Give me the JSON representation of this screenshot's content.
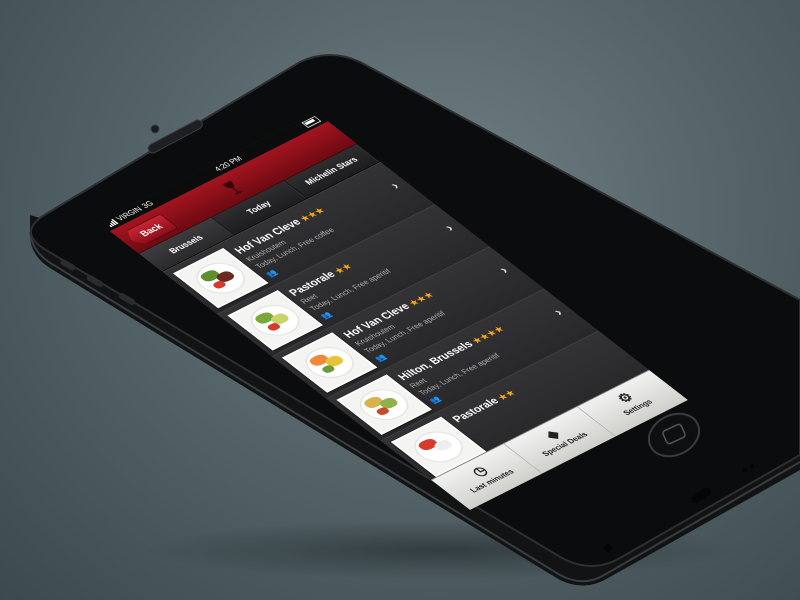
{
  "statusbar": {
    "carrier": "VIRGIN",
    "network": "3G",
    "time": "4:20 PM"
  },
  "navbar": {
    "back_label": "Back"
  },
  "segments": [
    {
      "label": "Brussels"
    },
    {
      "label": "Today"
    },
    {
      "label": "Michelin Stars"
    }
  ],
  "restaurants": [
    {
      "name": "Hof Van Cleve",
      "stars": "★★★",
      "area": "Kruishoutem",
      "meta": "Today, Lunch, Free coffee"
    },
    {
      "name": "Pastorale",
      "stars": "★★",
      "area": "Reet",
      "meta": "Today, Lunch, Free aperitif"
    },
    {
      "name": "Hof Van Cleve",
      "stars": "★★★",
      "area": "Kruishoutem",
      "meta": "Today, Lunch, Free aperitif"
    },
    {
      "name": "Hilton, Brussels",
      "stars": "★★★★",
      "area": "Reet",
      "meta": "Today, Lunch, Free aperitif"
    },
    {
      "name": "Pastorale",
      "stars": "★★",
      "area": "",
      "meta": ""
    }
  ],
  "tabbar": {
    "tabs": [
      {
        "label": "Last minutes",
        "icon": "clock-icon"
      },
      {
        "label": "Special Deals",
        "icon": "tag-icon"
      },
      {
        "label": "Settings",
        "icon": "gear-icon"
      }
    ]
  },
  "colors": {
    "navbar_red": "#a31420",
    "star_orange": "#f4a51c",
    "background": "#55656a"
  }
}
